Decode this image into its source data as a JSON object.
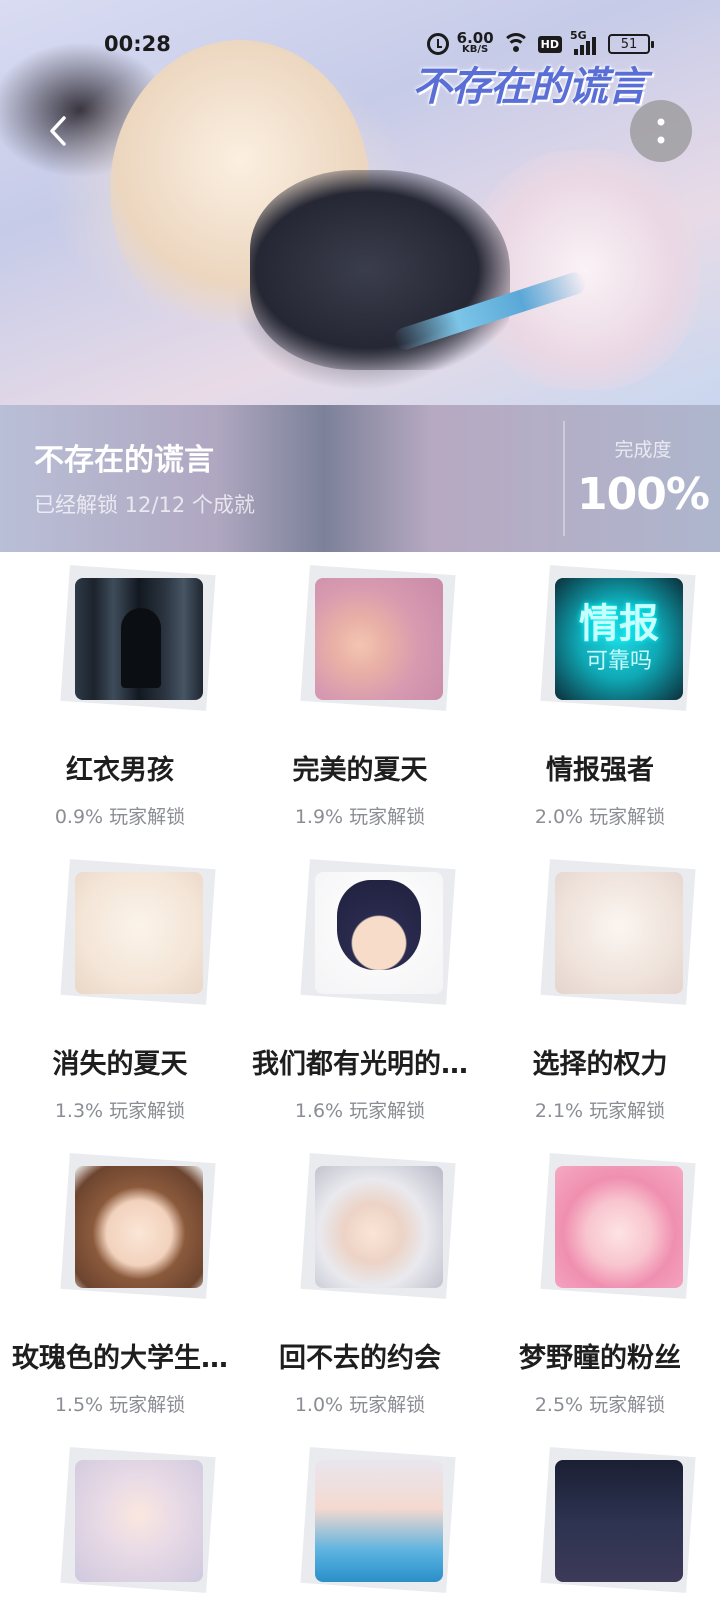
{
  "status_bar": {
    "time": "00:28",
    "net_speed": "6.00",
    "net_unit": "KB/S",
    "hd": "HD",
    "network": "5G",
    "battery": "51"
  },
  "hero": {
    "logo_text": "不存在的谎言"
  },
  "header": {
    "title": "不存在的谎言",
    "unlock_summary": "已经解锁 12/12 个成就",
    "completion_label": "完成度",
    "completion_value": "100%"
  },
  "achievements": [
    {
      "name": "红衣男孩",
      "rate": "0.9% 玩家解锁",
      "thumb": "dark-figure"
    },
    {
      "name": "完美的夏天",
      "rate": "1.9% 玩家解锁",
      "thumb": "pink-hair-girl"
    },
    {
      "name": "情报强者",
      "rate": "2.0% 玩家解锁",
      "thumb": "teal-sign",
      "thumb_text": "情报",
      "thumb_subtext": "可靠吗"
    },
    {
      "name": "消失的夏天",
      "rate": "1.3% 玩家解锁",
      "thumb": "sketch-girl"
    },
    {
      "name": "我们都有光明的…",
      "rate": "1.6% 玩家解锁",
      "thumb": "glasses-boy"
    },
    {
      "name": "选择的权力",
      "rate": "2.1% 玩家解锁",
      "thumb": "white-hair-girl"
    },
    {
      "name": "玫瑰色的大学生…",
      "rate": "1.5% 玩家解锁",
      "thumb": "brown-hair-girl"
    },
    {
      "name": "回不去的约会",
      "rate": "1.0% 玩家解锁",
      "thumb": "silver-hair-girl"
    },
    {
      "name": "梦野瞳的粉丝",
      "rate": "2.5% 玩家解锁",
      "thumb": "pink-twintails-girl"
    },
    {
      "name": "",
      "rate": "",
      "thumb": "lilac-hair-girl"
    },
    {
      "name": "",
      "rate": "",
      "thumb": "pool-girl"
    },
    {
      "name": "",
      "rate": "",
      "thumb": "night-scene"
    }
  ],
  "colors": {
    "title_text": "#1e1e1e",
    "rate_text": "#8a8d93",
    "logo_blue": "#5a6fd6"
  }
}
